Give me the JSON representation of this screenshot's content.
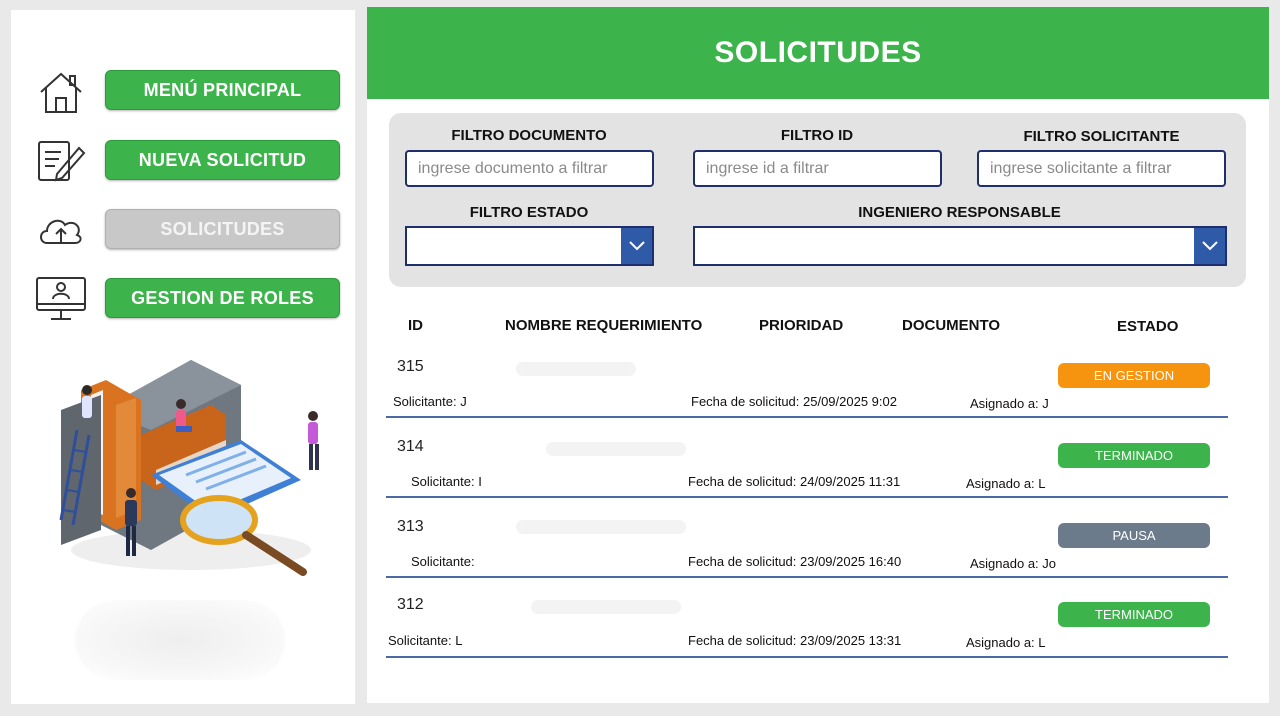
{
  "sidebar": {
    "nav": [
      {
        "label": "MENÚ PRINCIPAL",
        "icon": "home-icon"
      },
      {
        "label": "NUEVA SOLICITUD",
        "icon": "edit-document-icon"
      },
      {
        "label": "SOLICITUDES",
        "icon": "cloud-upload-icon",
        "active": true
      },
      {
        "label": "GESTION DE ROLES",
        "icon": "monitor-user-icon"
      }
    ],
    "illustration": "documents-illustration"
  },
  "header": {
    "title": "SOLICITUDES"
  },
  "filters": {
    "documento": {
      "label": "FILTRO DOCUMENTO",
      "placeholder": "ingrese documento a filtrar",
      "value": ""
    },
    "id": {
      "label": "FILTRO ID",
      "placeholder": "ingrese id a filtrar",
      "value": ""
    },
    "solicitante": {
      "label": "FILTRO SOLICITANTE",
      "placeholder": "ingrese solicitante a filtrar",
      "value": ""
    },
    "estado": {
      "label": "FILTRO ESTADO",
      "value": ""
    },
    "ingeniero": {
      "label": "INGENIERO RESPONSABLE",
      "value": ""
    }
  },
  "table": {
    "headers": {
      "id": "ID",
      "nombre": "NOMBRE REQUERIMIENTO",
      "prioridad": "PRIORIDAD",
      "documento": "DOCUMENTO",
      "estado": "ESTADO"
    },
    "rows": [
      {
        "id": "315",
        "solicitante": "Solicitante: J",
        "fecha": "Fecha de solicitud: 25/09/2025 9:02",
        "asignado": "Asignado a: J",
        "estado": "EN GESTION",
        "color": "#f7940f"
      },
      {
        "id": "314",
        "solicitante": "Solicitante: I",
        "fecha": "Fecha de solicitud: 24/09/2025 11:31",
        "asignado": "Asignado a: L",
        "estado": "TERMINADO",
        "color": "#3cb44b"
      },
      {
        "id": "313",
        "solicitante": "Solicitante:",
        "fecha": "Fecha de solicitud: 23/09/2025 16:40",
        "asignado": "Asignado a: Jo",
        "estado": "PAUSA",
        "color": "#6b7b8c"
      },
      {
        "id": "312",
        "solicitante": "Solicitante: L",
        "fecha": "Fecha de solicitud: 23/09/2025 13:31",
        "asignado": "Asignado a: L",
        "estado": "TERMINADO",
        "color": "#3cb44b"
      }
    ]
  },
  "colors": {
    "accent": "#3cb44b",
    "navy": "#1f2f6e",
    "dropdown": "#2f5aa8"
  }
}
